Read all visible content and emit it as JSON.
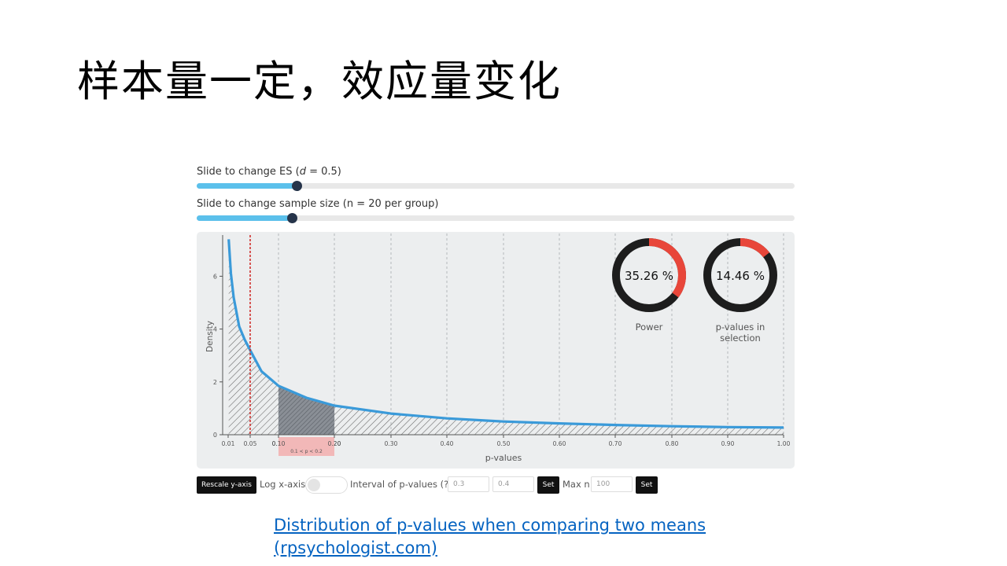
{
  "slide": {
    "title": "样本量一定，效应量变化"
  },
  "es_slider": {
    "prefix": "Slide to change ES (",
    "symbol": "d",
    "suffix": " = 0.5)",
    "value": 0.5,
    "fraction": 0.167
  },
  "n_slider": {
    "label": "Slide to change sample size (n = 20 per group)",
    "value": 20,
    "fraction": 0.159
  },
  "donuts": [
    {
      "label_lines": [
        "Power"
      ],
      "value_text": "35.26 %",
      "fraction": 0.3526
    },
    {
      "label_lines": [
        "p-values in",
        "selection"
      ],
      "value_text": "14.46 %",
      "fraction": 0.1446
    }
  ],
  "chart_data": {
    "type": "area",
    "xlabel": "p-values",
    "ylabel": "Density",
    "x_ticks": [
      "0.01",
      "0.05",
      "0.10",
      "0.20",
      "0.30",
      "0.40",
      "0.50",
      "0.60",
      "0.70",
      "0.80",
      "0.90",
      "1.00"
    ],
    "y_ticks": [
      "0",
      "2",
      "4",
      "6"
    ],
    "xlim": [
      0.01,
      1.0
    ],
    "ylim": [
      0,
      7.4
    ],
    "alpha_line": 0.05,
    "selection": {
      "from": 0.1,
      "to": 0.2,
      "label": "0.1 < p < 0.2"
    },
    "curve_x": [
      0.011,
      0.015,
      0.02,
      0.03,
      0.04,
      0.05,
      0.07,
      0.1,
      0.15,
      0.2,
      0.3,
      0.4,
      0.5,
      0.6,
      0.7,
      0.8,
      0.9,
      1.0
    ],
    "curve_y": [
      7.4,
      6.1,
      5.2,
      4.1,
      3.6,
      3.2,
      2.4,
      1.85,
      1.4,
      1.1,
      0.8,
      0.62,
      0.5,
      0.43,
      0.37,
      0.32,
      0.29,
      0.27
    ],
    "colors": {
      "curve": "#3a9ad9",
      "alpha_line": "#d0312d",
      "selection_band": "#f2b8b8"
    }
  },
  "controls": {
    "rescale_label": "Rescale y-axis",
    "log_label": "Log x-axis",
    "interval_label": "Interval of p-values (?)",
    "interval_low": "0.3",
    "interval_high": "0.4",
    "set_label": "Set",
    "maxn_label": "Max n",
    "maxn_value": "100"
  },
  "link": {
    "line1": "Distribution of p-values when comparing two means",
    "line2": "(rpsychologist.com)"
  }
}
